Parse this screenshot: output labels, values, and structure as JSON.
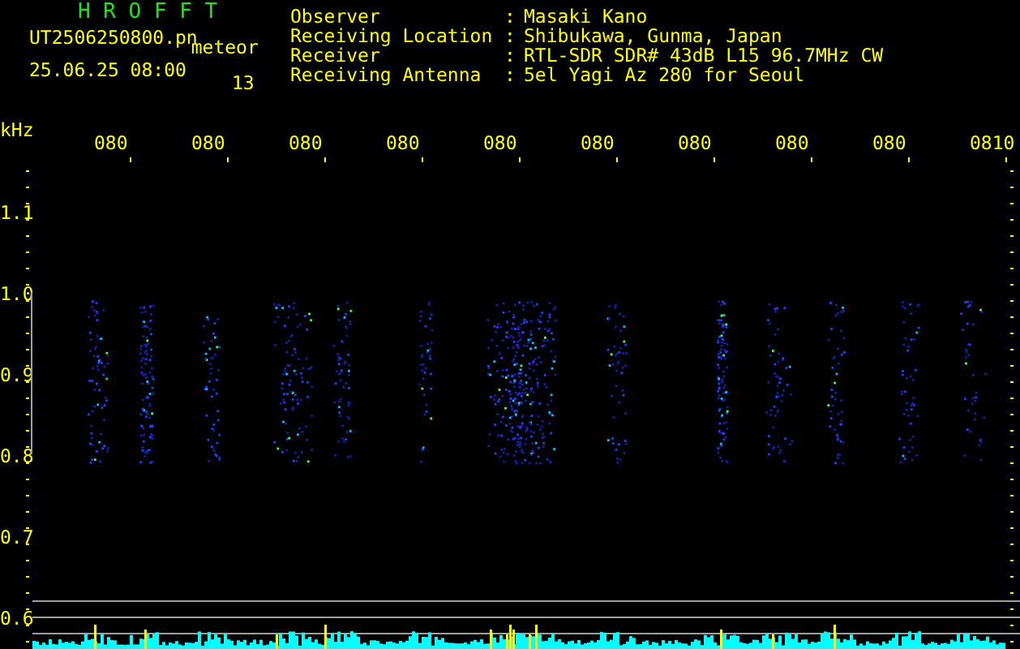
{
  "header": {
    "title": "H R O F F T",
    "file_name": "UT2506250800.pn",
    "category": "meteor",
    "date_time": "25.06.25 08:00",
    "count": "13"
  },
  "info": [
    {
      "label": "Observer",
      "separator": ":",
      "value": "Masaki Kano"
    },
    {
      "label": "Receiving Location",
      "separator": ":",
      "value": "Shibukawa, Gunma, Japan"
    },
    {
      "label": "Receiver",
      "separator": ":",
      "value": "RTL-SDR SDR# 43dB L15 96.7MHz CW"
    },
    {
      "label": "Receiving Antenna",
      "separator": ":",
      "value": "5el Yagi Az 280 for Seoul"
    }
  ],
  "plot": {
    "unit": "kHz",
    "time_labels": [
      "080",
      "080",
      "080",
      "080",
      "080",
      "080",
      "080",
      "080",
      "080",
      "0810"
    ],
    "frequency_labels": [
      "1.1",
      "1.0",
      "0.9",
      "0.8",
      "0.7",
      "0.6"
    ]
  }
}
